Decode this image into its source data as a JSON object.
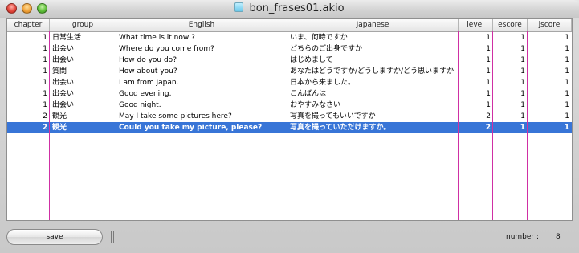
{
  "window": {
    "title": "bon_frases01.akio"
  },
  "table": {
    "columns": [
      "chapter",
      "group",
      "English",
      "Japanese",
      "level",
      "escore",
      "jscore"
    ],
    "rows": [
      [
        "1",
        "日常生活",
        "What time is it now ?",
        "いま、何時ですか",
        "1",
        "1",
        "1"
      ],
      [
        "1",
        "出会い",
        "Where do you come from?",
        "どちらのご出身ですか",
        "1",
        "1",
        "1"
      ],
      [
        "1",
        "出会い",
        "How do you do?",
        "はじめまして",
        "1",
        "1",
        "1"
      ],
      [
        "1",
        "質問",
        "How about you?",
        "あなたはどうですか/どうしますか/どう思いますか",
        "1",
        "1",
        "1"
      ],
      [
        "1",
        "出会い",
        "I am from Japan.",
        "日本から来ました。",
        "1",
        "1",
        "1"
      ],
      [
        "1",
        "出会い",
        "Good evening.",
        "こんばんは",
        "1",
        "1",
        "1"
      ],
      [
        "1",
        "出会い",
        "Good night.",
        "おやすみなさい",
        "1",
        "1",
        "1"
      ],
      [
        "2",
        "観光",
        "May I take some pictures here?",
        "写真を撮ってもいいですか",
        "2",
        "1",
        "1"
      ],
      [
        "2",
        "観光",
        "Could you take my picture, please?",
        "写真を撮っていただけますか。",
        "2",
        "1",
        "1"
      ]
    ],
    "selected_row_index": 8
  },
  "footer": {
    "save_label": "save",
    "number_label": "number :",
    "number_value": "8"
  },
  "colors": {
    "selection": "#3875d7",
    "column_divider": "#cf2fa4"
  }
}
